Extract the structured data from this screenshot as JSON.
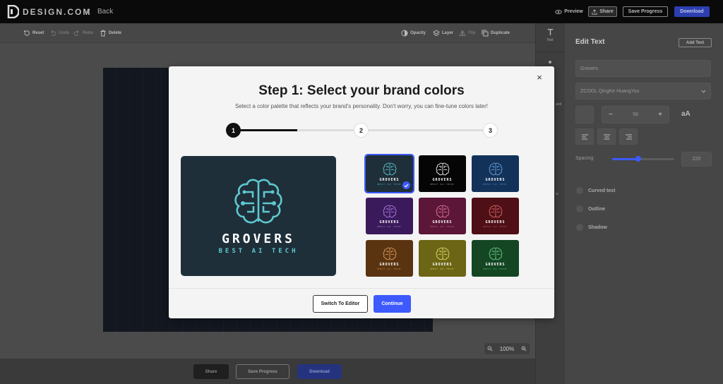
{
  "topbar": {
    "logo_text": "DESIGN.COM",
    "back_label": "Back",
    "preview_label": "Preview",
    "share_label": "Share",
    "save_progress_label": "Save Progress",
    "download_label": "Download"
  },
  "toolbar": {
    "reset": "Reset",
    "undo": "Undo",
    "redo": "Redo",
    "delete": "Delete",
    "opacity": "Opacity",
    "layer": "Layer",
    "flip": "Flip",
    "duplicate": "Duplicate"
  },
  "strip": {
    "text_label": "Text",
    "partial_label_1": "and",
    "partial_label_2": "w"
  },
  "panel": {
    "title": "Edit Text",
    "add_text": "Add Text",
    "text_value": "Grovers",
    "font_value": "ZCOOL QingKe HuangYou",
    "size_value": "58",
    "case_toggle": "aA",
    "minus": "−",
    "plus": "+",
    "spacing_label": "Spacing",
    "spacing_value": "220",
    "spacing_fraction": 0.42,
    "options": [
      "Curved text",
      "Outline",
      "Shadow"
    ]
  },
  "bottom": {
    "share": "Share",
    "save_progress": "Save Progress",
    "download": "Download"
  },
  "zoom": {
    "value": "100%"
  },
  "modal": {
    "title": "Step 1: Select your brand colors",
    "subtitle": "Select a color palette that reflects your brand's personality. Don't worry, you can fine-tune colors later!",
    "steps": [
      "1",
      "2",
      "3"
    ],
    "current_step": 1,
    "close_glyph": "×",
    "preview": {
      "name": "GROVERS",
      "tagline": "BEST AI TECH",
      "bg": "#1e2f3a",
      "icon_color": "#5fc8cf",
      "name_color": "#ffffff",
      "tag_color": "#5fc8cf"
    },
    "palettes": [
      {
        "bg": "#1e2f3a",
        "icon": "#5fc8cf",
        "tag": "#5fc8cf",
        "selected": true
      },
      {
        "bg": "#050505",
        "icon": "#ffffff",
        "tag": "#bbbbbb",
        "selected": false
      },
      {
        "bg": "#13325a",
        "icon": "#6aa6e0",
        "tag": "#6aa6e0",
        "selected": false
      },
      {
        "bg": "#3b1a5c",
        "icon": "#b07de0",
        "tag": "#c58be8",
        "selected": false
      },
      {
        "bg": "#5c1638",
        "icon": "#e07a9c",
        "tag": "#e07a9c",
        "selected": false
      },
      {
        "bg": "#4e0f16",
        "icon": "#e06a6a",
        "tag": "#e06a6a",
        "selected": false
      },
      {
        "bg": "#5a3411",
        "icon": "#e0a060",
        "tag": "#e0a060",
        "selected": false
      },
      {
        "bg": "#6b6515",
        "icon": "#e6e070",
        "tag": "#e6e070",
        "selected": false
      },
      {
        "bg": "#144623",
        "icon": "#6ecf84",
        "tag": "#6ecf84",
        "selected": false
      }
    ],
    "palette_name": "GROVERS",
    "palette_tag": "BEST AI TECH",
    "switch_label": "Switch To Editor",
    "continue_label": "Continue"
  },
  "colors": {
    "accent": "#3d5afe",
    "step_active": "#111111"
  },
  "icons": [
    "logo-icon",
    "chevron-left-icon",
    "eye-icon",
    "share-icon",
    "reset-icon",
    "undo-icon",
    "redo-icon",
    "trash-icon",
    "opacity-icon",
    "layers-icon",
    "flip-icon",
    "duplicate-icon",
    "text-icon",
    "close-icon",
    "check-icon",
    "brain-icon",
    "zoom-in-icon",
    "zoom-out-icon",
    "align-left-icon",
    "align-center-icon",
    "align-right-icon",
    "chevron-down-icon"
  ]
}
